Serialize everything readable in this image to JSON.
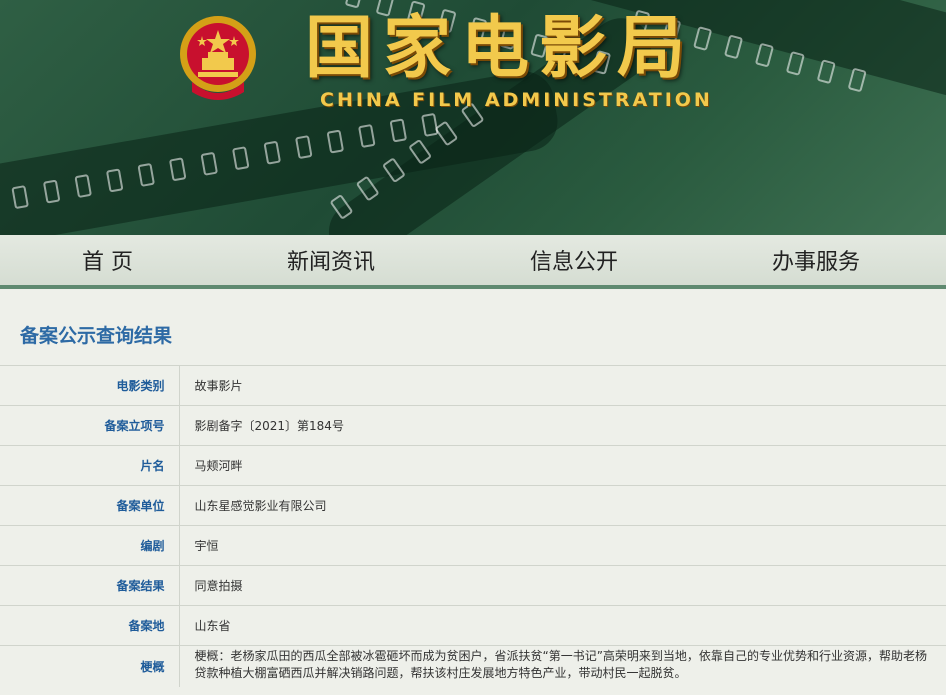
{
  "header": {
    "title_cn": "国家电影局",
    "title_en": "CHINA FILM ADMINISTRATION",
    "emblem_icon": "national-emblem-icon"
  },
  "nav": {
    "items": [
      {
        "label": "首 页"
      },
      {
        "label": "新闻资讯"
      },
      {
        "label": "信息公开"
      },
      {
        "label": "办事服务"
      }
    ]
  },
  "main": {
    "title": "备案公示查询结果",
    "rows": [
      {
        "label": "电影类别",
        "value": "故事影片"
      },
      {
        "label": "备案立项号",
        "value": "影剧备字〔2021〕第184号"
      },
      {
        "label": "片名",
        "value": "马颊河畔"
      },
      {
        "label": "备案单位",
        "value": "山东星感觉影业有限公司"
      },
      {
        "label": "编剧",
        "value": "宇恒"
      },
      {
        "label": "备案结果",
        "value": "同意拍摄"
      },
      {
        "label": "备案地",
        "value": "山东省"
      },
      {
        "label": "梗概",
        "value": "梗概：老杨家瓜田的西瓜全部被冰雹砸坏而成为贫困户，省派扶贫“第一书记”高荣明来到当地，依靠自己的专业优势和行业资源，帮助老杨贷款种植大棚富硒西瓜并解决销路问题，帮扶该村庄发展地方特色产业，带动村民一起脱贫。"
      }
    ]
  },
  "colors": {
    "banner_green": "#2f5f44",
    "gold": "#f2c94c",
    "label_blue": "#1f5c9a",
    "title_blue": "#2d6aa5",
    "nav_border": "#5f8a70"
  }
}
